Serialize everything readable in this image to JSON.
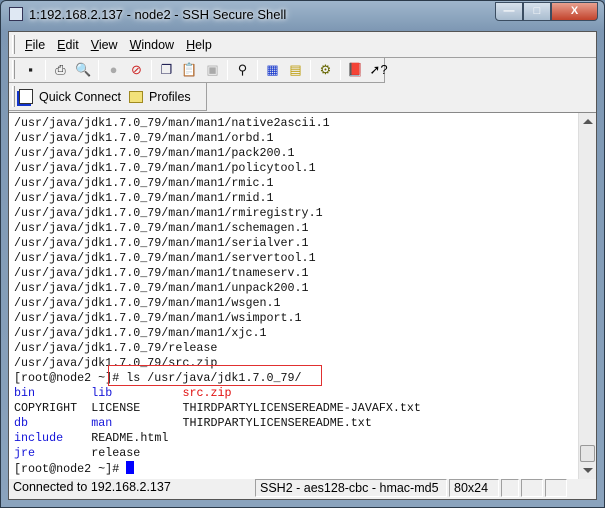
{
  "window": {
    "title": "1:192.168.2.137 - node2 - SSH Secure Shell",
    "min": "—",
    "max": "□",
    "close": "X"
  },
  "menu": [
    {
      "key": "F",
      "rest": "ile"
    },
    {
      "key": "E",
      "rest": "dit"
    },
    {
      "key": "V",
      "rest": "iew"
    },
    {
      "key": "W",
      "rest": "indow"
    },
    {
      "key": "H",
      "rest": "elp"
    }
  ],
  "toolbar": [
    "save",
    "print",
    "print-preview",
    "disconnect",
    "disconnect-disabled",
    "copy",
    "paste",
    "paste-disabled",
    "find",
    "new-terminal",
    "new-file-transfer",
    "settings",
    "help-book",
    "context-help"
  ],
  "quickbar": {
    "quick_connect": "Quick Connect",
    "profiles": "Profiles"
  },
  "terminal": {
    "paths": [
      "/usr/java/jdk1.7.0_79/man/man1/native2ascii.1",
      "/usr/java/jdk1.7.0_79/man/man1/orbd.1",
      "/usr/java/jdk1.7.0_79/man/man1/pack200.1",
      "/usr/java/jdk1.7.0_79/man/man1/policytool.1",
      "/usr/java/jdk1.7.0_79/man/man1/rmic.1",
      "/usr/java/jdk1.7.0_79/man/man1/rmid.1",
      "/usr/java/jdk1.7.0_79/man/man1/rmiregistry.1",
      "/usr/java/jdk1.7.0_79/man/man1/schemagen.1",
      "/usr/java/jdk1.7.0_79/man/man1/serialver.1",
      "/usr/java/jdk1.7.0_79/man/man1/servertool.1",
      "/usr/java/jdk1.7.0_79/man/man1/tnameserv.1",
      "/usr/java/jdk1.7.0_79/man/man1/unpack200.1",
      "/usr/java/jdk1.7.0_79/man/man1/wsgen.1",
      "/usr/java/jdk1.7.0_79/man/man1/wsimport.1",
      "/usr/java/jdk1.7.0_79/man/man1/xjc.1",
      "/usr/java/jdk1.7.0_79/release",
      "/usr/java/jdk1.7.0_79/src.zip"
    ],
    "prompt": "[root@node2 ~]# ",
    "command": "ls /usr/java/jdk1.7.0_79/",
    "listing": [
      [
        {
          "t": "bin",
          "c": "blue"
        },
        {
          "t": "lib",
          "c": "blue"
        },
        {
          "t": "src.zip",
          "c": "red"
        }
      ],
      [
        {
          "t": "COPYRIGHT",
          "c": ""
        },
        {
          "t": "LICENSE",
          "c": ""
        },
        {
          "t": "THIRDPARTYLICENSEREADME-JAVAFX.txt",
          "c": ""
        }
      ],
      [
        {
          "t": "db",
          "c": "blue"
        },
        {
          "t": "man",
          "c": "blue"
        },
        {
          "t": "THIRDPARTYLICENSEREADME.txt",
          "c": ""
        }
      ],
      [
        {
          "t": "include",
          "c": "blue"
        },
        {
          "t": "README.html",
          "c": ""
        },
        {
          "t": "",
          "c": ""
        }
      ],
      [
        {
          "t": "jre",
          "c": "blue"
        },
        {
          "t": "release",
          "c": ""
        },
        {
          "t": "",
          "c": ""
        }
      ]
    ],
    "colors": {
      "dir": "#1414d8",
      "archive": "#e01010",
      "highlight_box": "#e03030",
      "cursor": "#0000ff"
    }
  },
  "status": {
    "connection": "Connected to 192.168.2.137",
    "cipher": "SSH2 - aes128-cbc - hmac-md5",
    "size": "80x24"
  }
}
